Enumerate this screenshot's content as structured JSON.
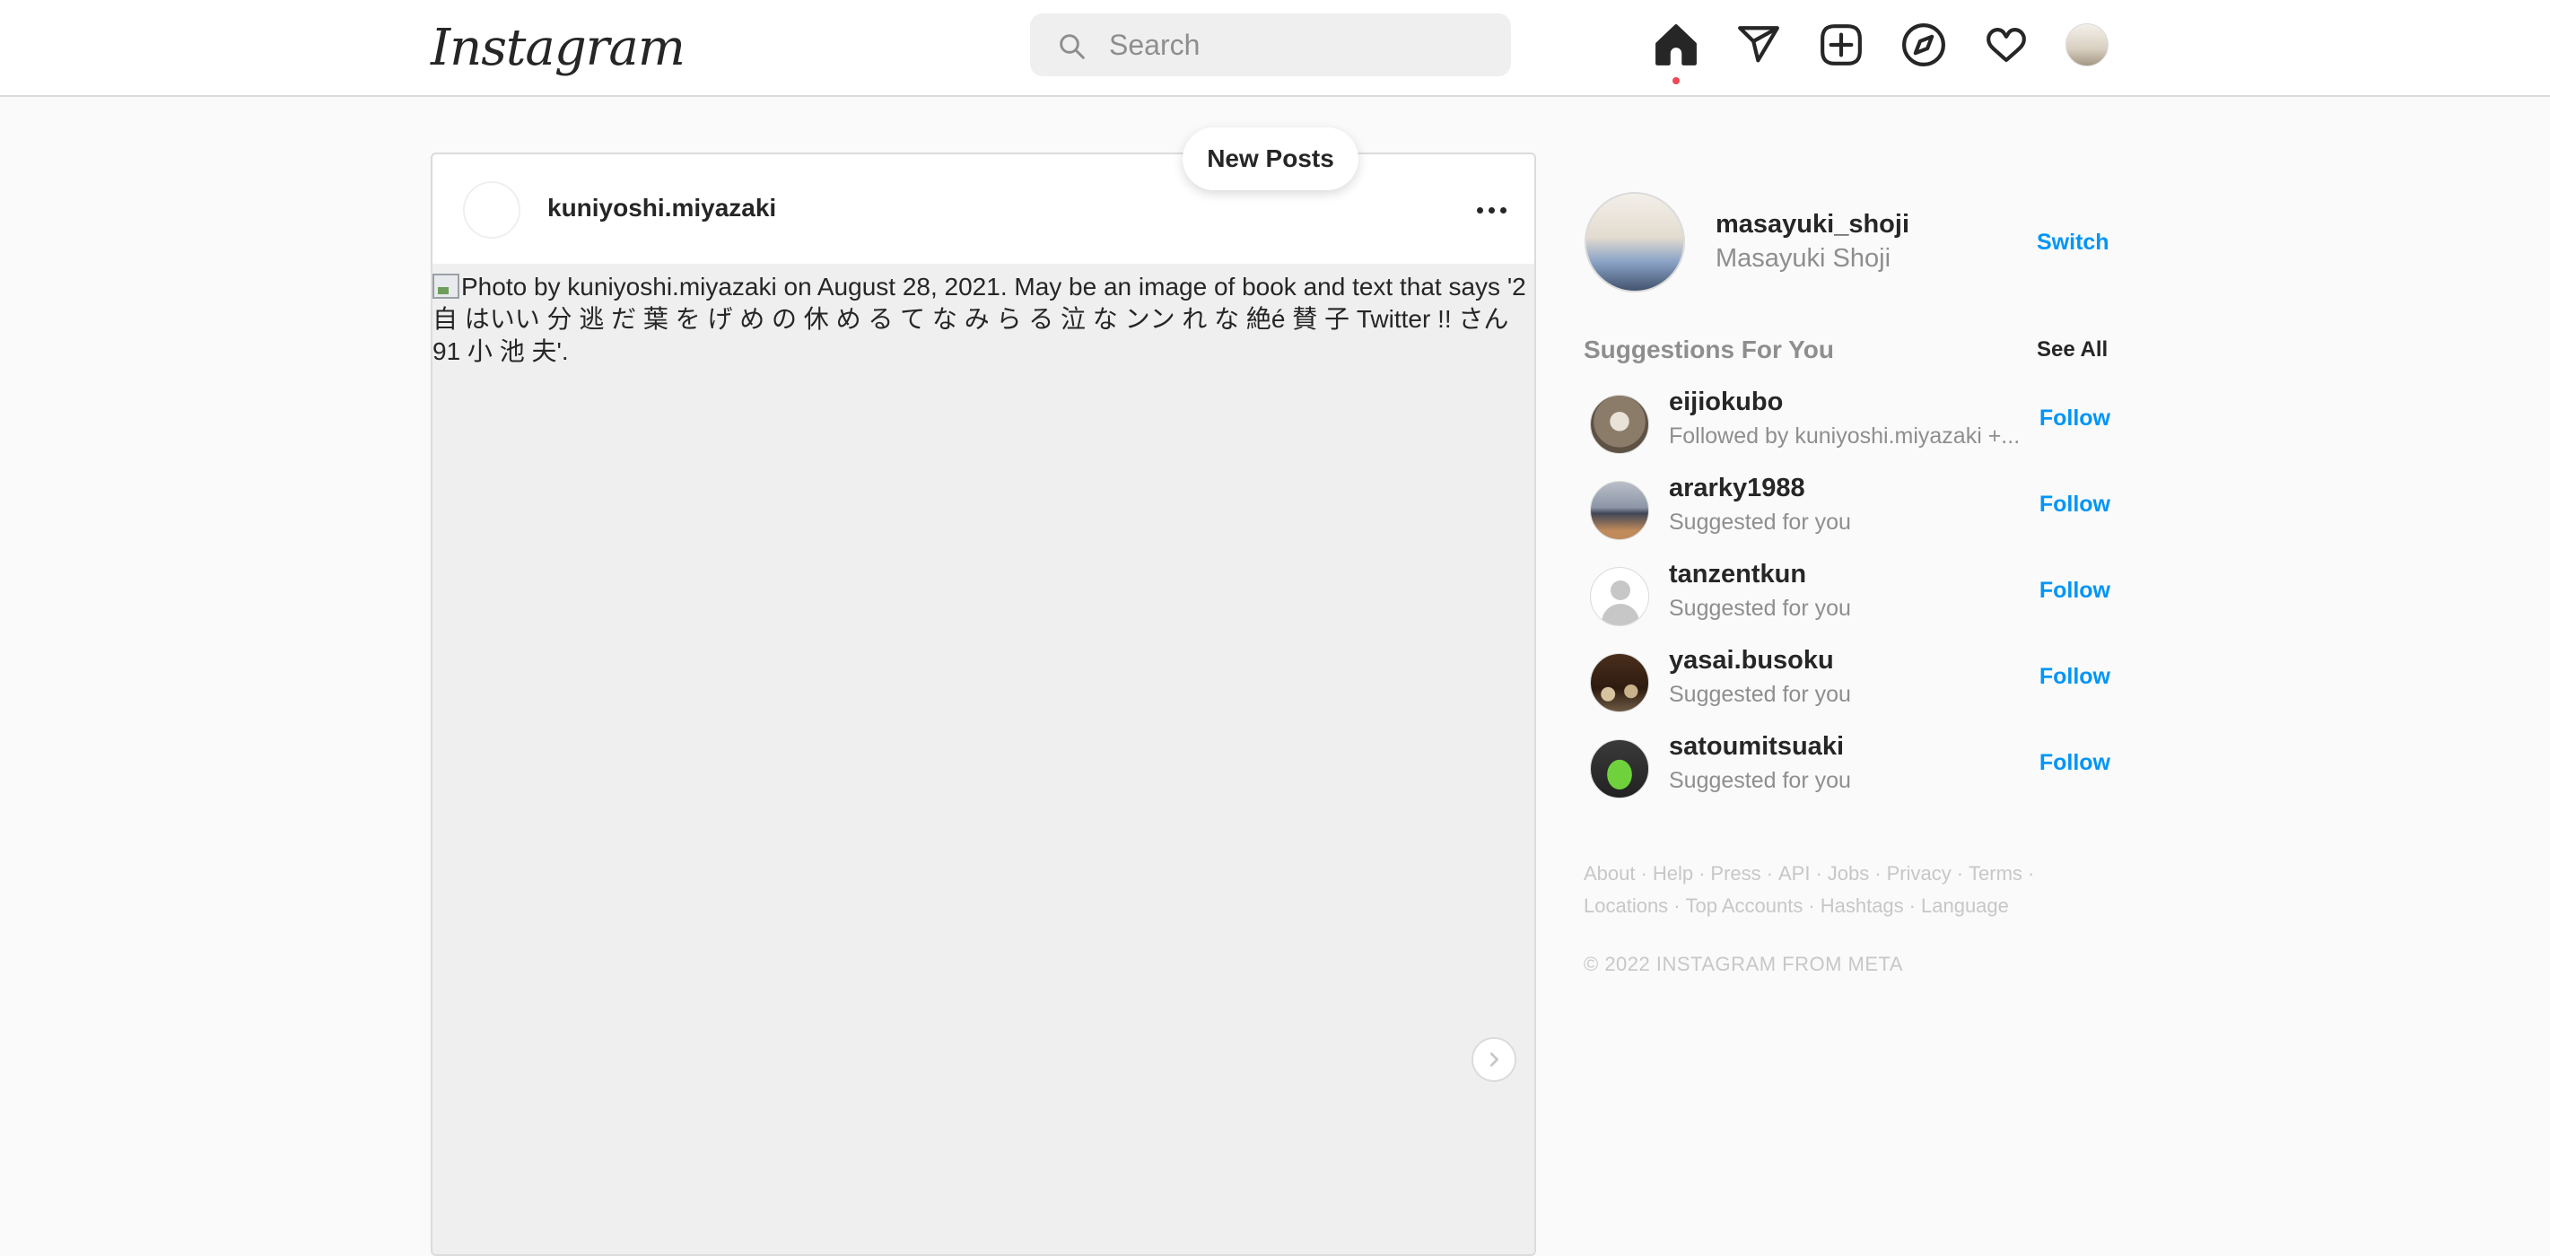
{
  "nav": {
    "logo": "Instagram",
    "search_placeholder": "Search",
    "icons": [
      "home-icon",
      "direct-message-icon",
      "new-post-icon",
      "explore-icon",
      "activity-heart-icon",
      "profile-avatar"
    ],
    "active_dot_color": "#ed4956"
  },
  "new_posts_label": "New Posts",
  "post": {
    "username": "kuniyoshi.miyazaki",
    "image_alt": "Photo by kuniyoshi.miyazaki on August 28, 2021. May be an image of book and text that says '2 自 はいい 分 逃 だ 葉 を げ め の 休 め る て な み ら る 泣 な ンン れ な 絶é 賛 子 Twitter !! さん 91 小 池 夫'."
  },
  "sidebar": {
    "me": {
      "username": "masayuki_shoji",
      "full_name": "Masayuki Shoji",
      "switch_label": "Switch"
    },
    "suggestions_title": "Suggestions For You",
    "see_all_label": "See All",
    "suggestions": [
      {
        "username": "eijiokubo",
        "subtitle": "Followed by kuniyoshi.miyazaki +...",
        "action": "Follow"
      },
      {
        "username": "ararky1988",
        "subtitle": "Suggested for you",
        "action": "Follow"
      },
      {
        "username": "tanzentkun",
        "subtitle": "Suggested for you",
        "action": "Follow"
      },
      {
        "username": "yasai.busoku",
        "subtitle": "Suggested for you",
        "action": "Follow"
      },
      {
        "username": "satoumitsuaki",
        "subtitle": "Suggested for you",
        "action": "Follow"
      }
    ],
    "footer_links": [
      "About",
      "Help",
      "Press",
      "API",
      "Jobs",
      "Privacy",
      "Terms",
      "Locations",
      "Top Accounts",
      "Hashtags",
      "Language"
    ],
    "copyright": "© 2022 INSTAGRAM FROM META"
  },
  "colors": {
    "accent": "#0095f6",
    "muted_text": "#8e8e8e",
    "border": "#dbdbdb",
    "background": "#fafafa"
  }
}
